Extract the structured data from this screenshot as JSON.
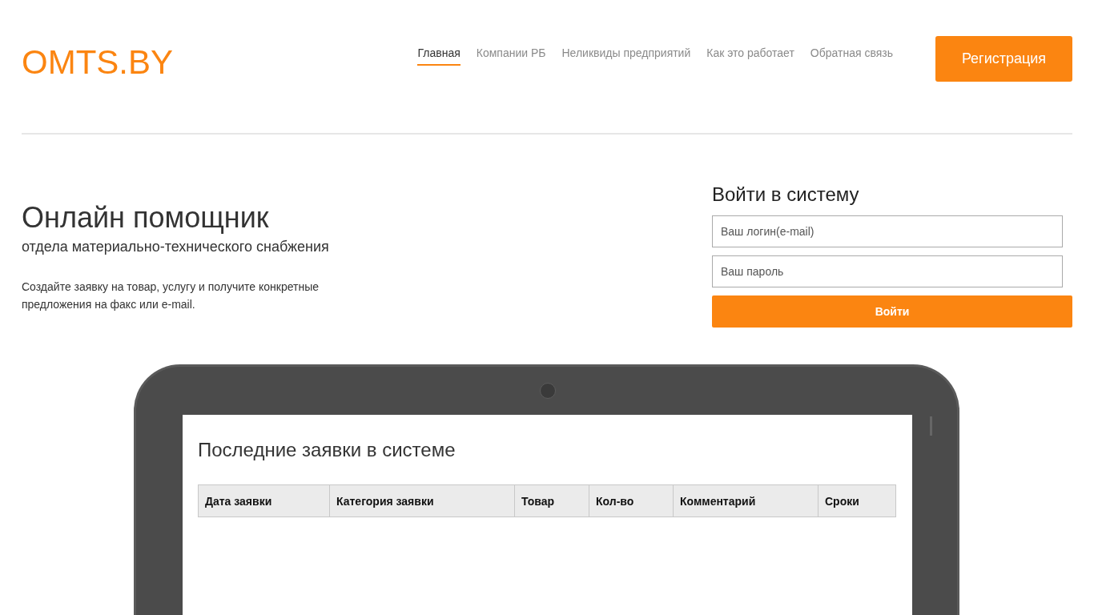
{
  "logo": "OMTS.BY",
  "nav": [
    {
      "label": "Главная",
      "selected": true
    },
    {
      "label": "Компании РБ",
      "selected": false
    },
    {
      "label": "Неликвиды предприятий",
      "selected": false
    },
    {
      "label": "Как это работает",
      "selected": false
    },
    {
      "label": "Обратная связь",
      "selected": false
    }
  ],
  "register_button": "Регистрация",
  "hero": {
    "title": "Онлайн помощник",
    "subtitle": "отдела материально-технического снабжения",
    "text": "Создайте заявку на товар, услугу и получите конкретные предложения на факс или e-mail."
  },
  "login": {
    "title": "Войти в систему",
    "login_field": {
      "placeholder": "Ваш логин(e-mail)"
    },
    "password_field": {
      "placeholder": "Ваш пароль"
    },
    "button": "Войти"
  },
  "tablet": {
    "title": "Последние заявки в системе",
    "table": {
      "columns": [
        "Дата заявки",
        "Категория заявки",
        "Товар",
        "Кол-во",
        "Комментарий",
        "Сроки"
      ]
    }
  }
}
